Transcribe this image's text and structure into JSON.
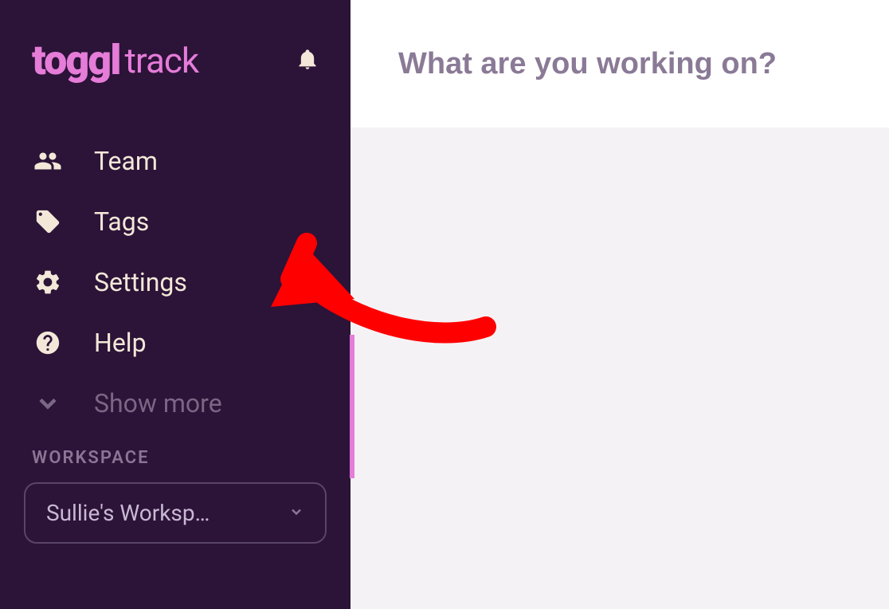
{
  "logo": {
    "brand": "toggl",
    "product": "track"
  },
  "sidebar": {
    "items": [
      {
        "label": "Team",
        "icon": "team-icon"
      },
      {
        "label": "Tags",
        "icon": "tag-icon"
      },
      {
        "label": "Settings",
        "icon": "gear-icon"
      },
      {
        "label": "Help",
        "icon": "help-icon"
      },
      {
        "label": "Show more",
        "icon": "chevron-down-icon",
        "muted": true
      }
    ]
  },
  "workspace": {
    "header": "WORKSPACE",
    "selected": "Sullie's Worksp…"
  },
  "main": {
    "prompt_placeholder": "What are you working on?"
  }
}
